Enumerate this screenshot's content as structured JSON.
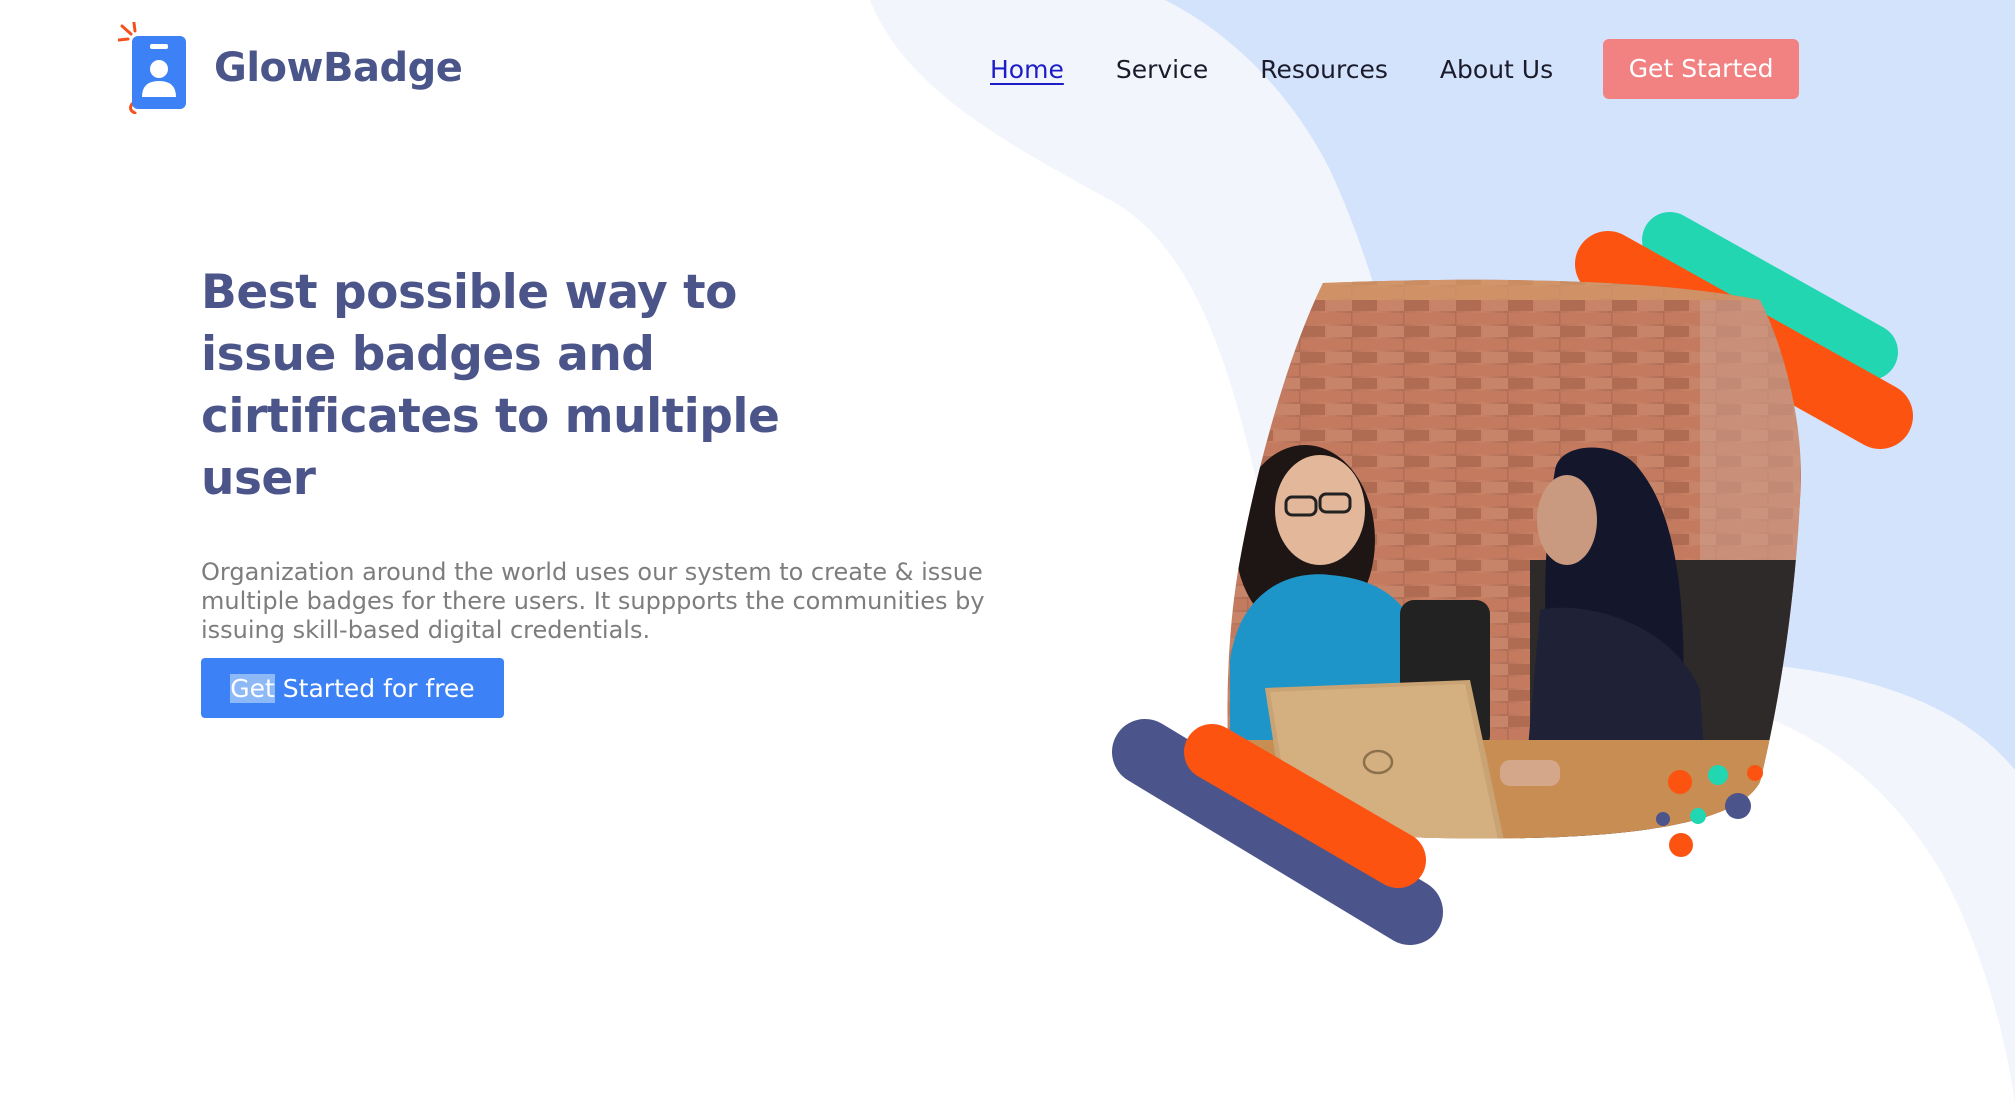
{
  "brand": {
    "name": "GlowBadge",
    "logo_icon": "id-badge-icon"
  },
  "nav": {
    "items": [
      {
        "label": "Home",
        "active": true
      },
      {
        "label": "Service",
        "active": false
      },
      {
        "label": "Resources",
        "active": false
      },
      {
        "label": "About Us",
        "active": false
      }
    ],
    "cta_label": "Get Started"
  },
  "hero": {
    "title": "Best possible way to issue badges and cirtificates to multiple user",
    "description": "Organization around the world uses our system to create & issue multiple badges for there users. It suppports the communities by issuing skill-based digital credentials.",
    "cta_selected_part": "Get",
    "cta_rest": " Started for free"
  },
  "colors": {
    "brand_text": "#4b558a",
    "primary_blue": "#3c82f6",
    "nav_cta": "#f28181",
    "bg_light": "#f2f6fc",
    "bg_blue": "#d2e3fb",
    "accent_orange": "#fc5311",
    "accent_teal": "#22d6b2",
    "accent_navy": "#4b548b"
  },
  "illustration": {
    "photo": "two-women-at-laptop-meeting"
  }
}
